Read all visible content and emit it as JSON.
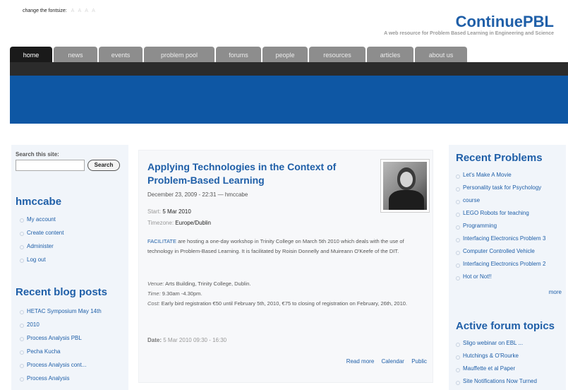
{
  "header": {
    "font_size_label": "change the fontsize:",
    "font_size_options": "A A A A",
    "site_title": "ContinuePBL",
    "tagline": "A web resource for Problem Based Learning in Engineering and Science"
  },
  "nav": [
    "home",
    "news",
    "events",
    "problem pool",
    "forums",
    "people",
    "resources",
    "articles",
    "about us"
  ],
  "search": {
    "label": "Search this site:",
    "button": "Search",
    "value": ""
  },
  "user_block": {
    "title": "hmccabe",
    "items": [
      "My account",
      "Create content",
      "Administer",
      "Log out"
    ]
  },
  "blog_block": {
    "title": "Recent blog posts",
    "items": [
      "HETAC Symposium May 14th",
      "2010",
      "Process Analysis PBL",
      "Pecha Kucha",
      "Process Analysis cont...",
      "Process Analysis"
    ]
  },
  "post": {
    "title": "Applying Technologies in the Context of Problem-Based Learning",
    "date_author": "December 23, 2009 - 22:31 — hmccabe",
    "start_label": "Start:",
    "start_value": "5 Mar 2010",
    "timezone_label": "Timezone:",
    "timezone_value": "Europe/Dublin",
    "body_accent": "FACILITATE",
    "body": " are hosting a one-day workshop in Trinity College on March 5th 2010 which deals with the use of technology in Problem-Based Learning. It is facilitated by Roisin Donnelly and Muireann O'Keefe of the DIT.",
    "venue_label": "Venue:",
    "venue": "Arts Building, Trinity College, Dublin.",
    "time_label": "Time:",
    "time": "9.30am -4.30pm.",
    "cost_label": "Cost:",
    "cost": "Early bird registration €50 until February 5th, 2010, €75 to closing of registration on February, 26th, 2010.",
    "date_label": "Date:",
    "date_value": "5 Mar 2010 09:30 - 16:30",
    "links": [
      "Read more",
      "Calendar",
      "Public"
    ]
  },
  "problems_block": {
    "title": "Recent Problems",
    "items": [
      "Let's Make A Movie",
      "Personality task for Psychology",
      "course",
      "LEGO Robots for teaching",
      "Programming",
      "Interfacing Electronics Problem 3",
      "Computer Controlled Vehicle",
      "Interfacing Electronics Problem 2",
      "Hot or Not!!"
    ],
    "more": "more"
  },
  "forum_block": {
    "title": "Active forum topics",
    "items": [
      "Sligo webinar on EBL ...",
      "Hutchings & O'Rourke",
      "Mauffette et al Paper",
      "Site Notifications Now Turned"
    ]
  },
  "colors": {
    "brand": "#1f5fa8",
    "banner": "#0e57a4",
    "nav_bar": "#2b2b2b"
  }
}
